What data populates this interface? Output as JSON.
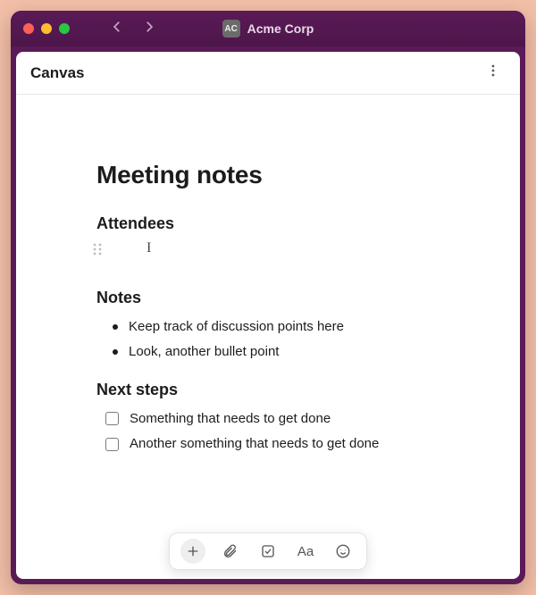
{
  "workspace": {
    "badge": "AC",
    "name": "Acme Corp"
  },
  "page": {
    "title": "Canvas"
  },
  "doc": {
    "title": "Meeting notes",
    "sections": {
      "attendees": {
        "heading": "Attendees"
      },
      "notes": {
        "heading": "Notes",
        "bullets": [
          "Keep track of discussion points here",
          "Look, another bullet point"
        ]
      },
      "next_steps": {
        "heading": "Next steps",
        "items": [
          {
            "text": "Something that needs to get done",
            "checked": false
          },
          {
            "text": "Another something that needs to get done",
            "checked": false
          }
        ]
      }
    }
  },
  "toolbar": {
    "text_format_label": "Aa"
  }
}
